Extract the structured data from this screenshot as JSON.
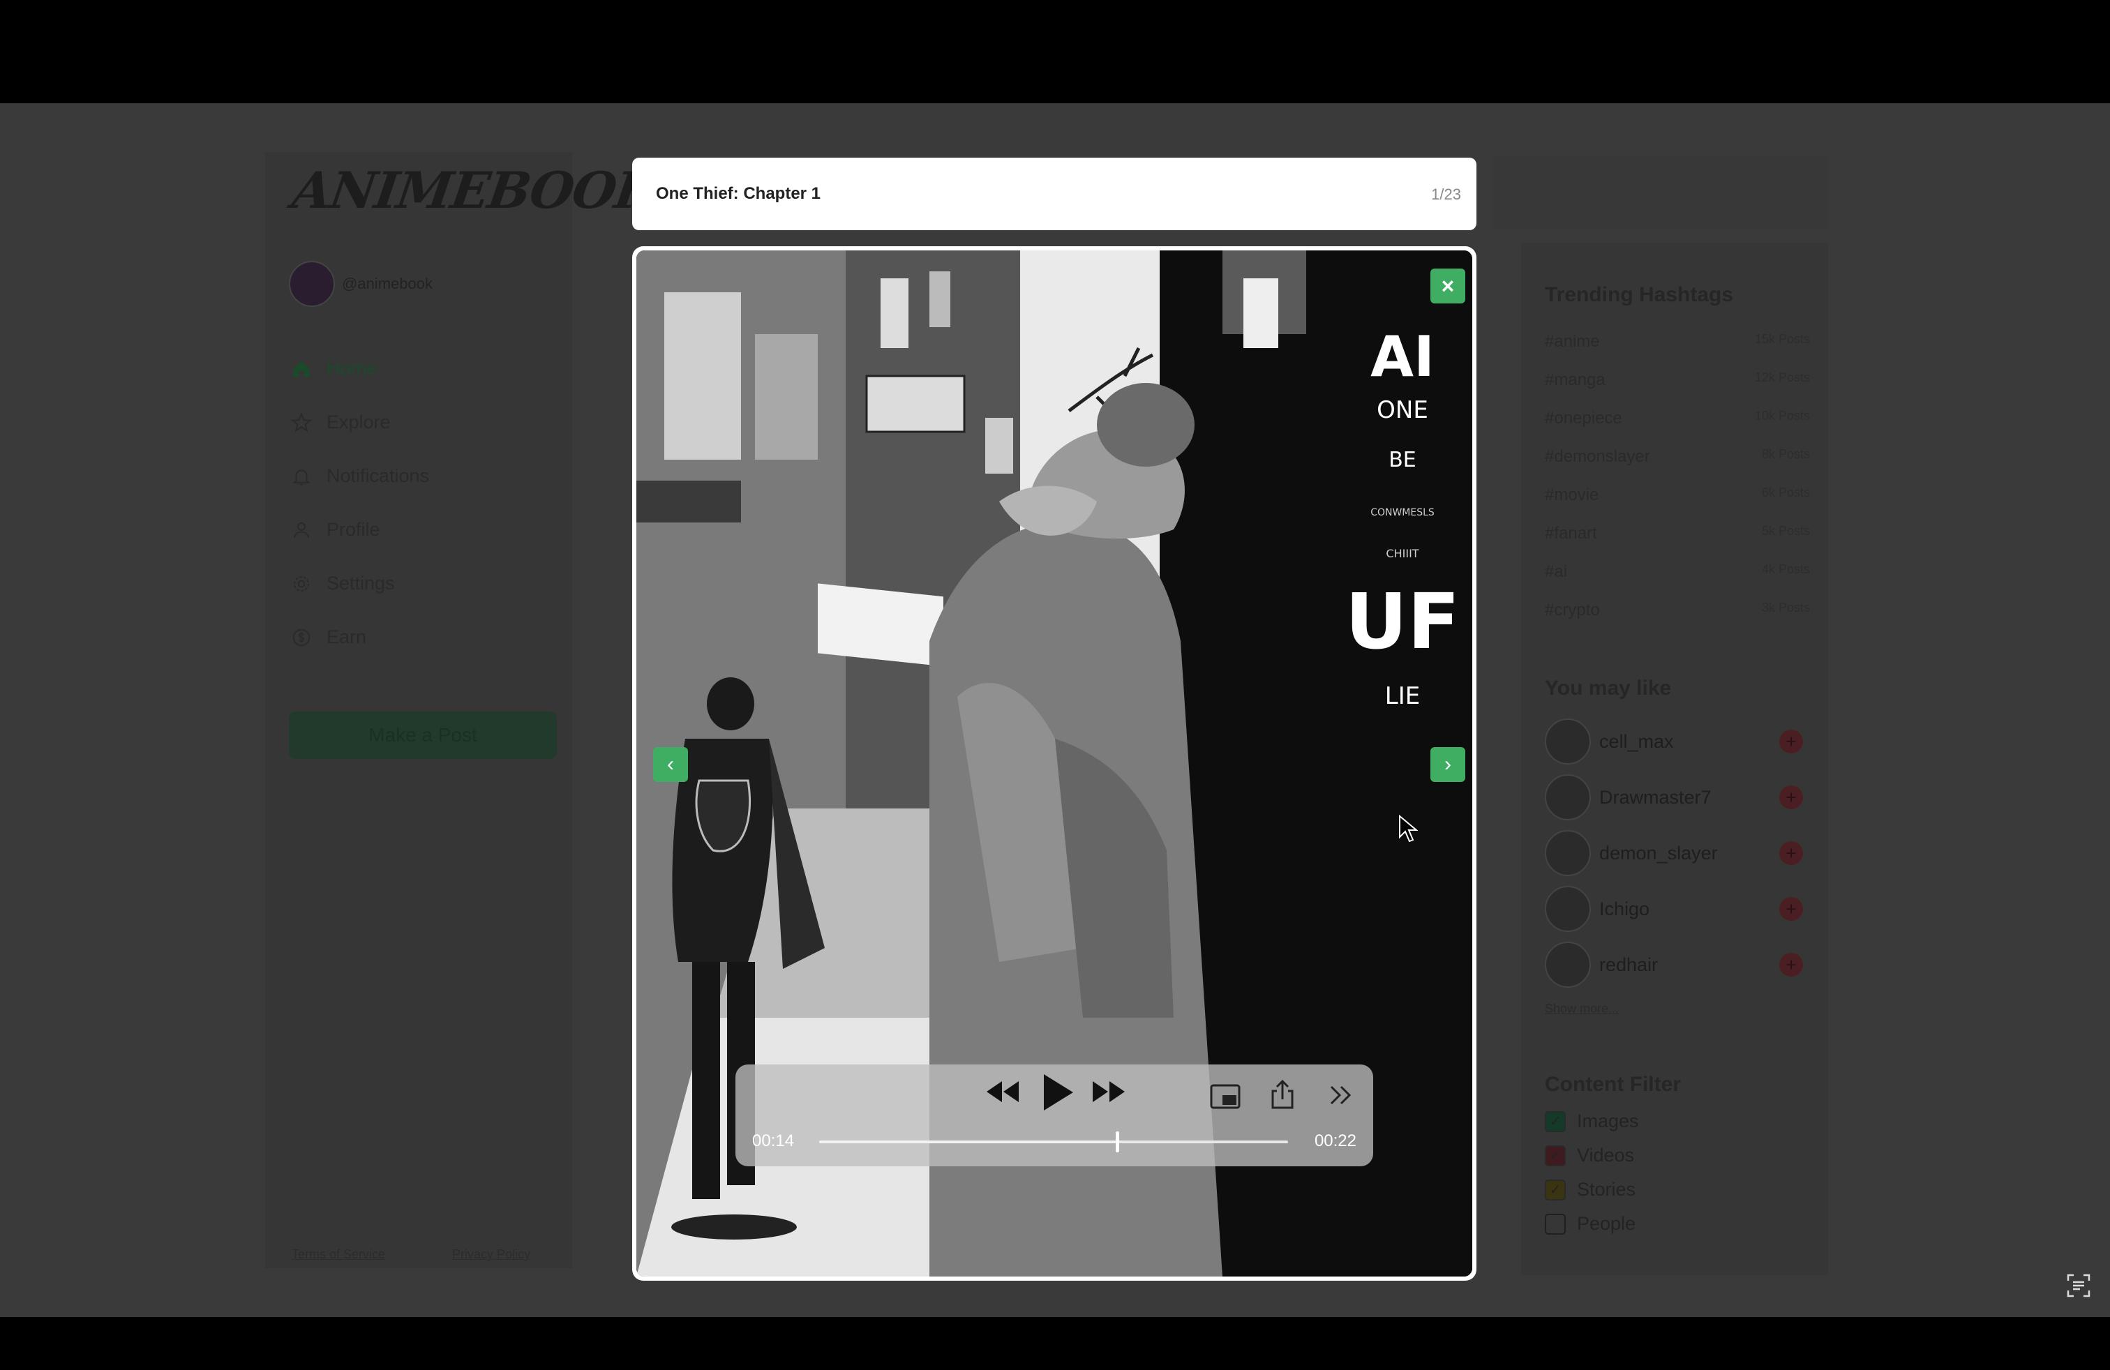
{
  "app": {
    "logo_text": "ANIMEBOOK",
    "handle": "@animebook"
  },
  "nav": {
    "items": [
      {
        "label": "Home",
        "icon": "home-icon"
      },
      {
        "label": "Explore",
        "icon": "star-icon"
      },
      {
        "label": "Notifications",
        "icon": "bell-icon"
      },
      {
        "label": "Profile",
        "icon": "user-icon"
      },
      {
        "label": "Settings",
        "icon": "gear-icon"
      },
      {
        "label": "Earn",
        "icon": "coin-icon"
      }
    ],
    "make_post": "Make a Post"
  },
  "footer": {
    "terms": "Terms of Service",
    "privacy": "Privacy Policy"
  },
  "trending": {
    "title": "Trending Hashtags",
    "items": [
      {
        "tag": "#anime",
        "count": "15k Posts"
      },
      {
        "tag": "#manga",
        "count": "12k Posts"
      },
      {
        "tag": "#onepiece",
        "count": "10k Posts"
      },
      {
        "tag": "#demonslayer",
        "count": "8k Posts"
      },
      {
        "tag": "#movie",
        "count": "6k Posts"
      },
      {
        "tag": "#fanart",
        "count": "5k Posts"
      },
      {
        "tag": "#ai",
        "count": "4k Posts"
      },
      {
        "tag": "#crypto",
        "count": "3k Posts"
      }
    ]
  },
  "you_may_like": {
    "title": "You may like",
    "users": [
      "cell_max",
      "Drawmaster7",
      "demon_slayer",
      "Ichigo",
      "redhair"
    ],
    "show_more": "Show more..."
  },
  "content_filter": {
    "title": "Content Filter",
    "items": [
      {
        "label": "Images",
        "checked": true,
        "color": "#1f8f4e"
      },
      {
        "label": "Videos",
        "checked": true,
        "color": "#c0394a"
      },
      {
        "label": "Stories",
        "checked": true,
        "color": "#c8b42a"
      },
      {
        "label": "People",
        "checked": false,
        "color": "#ffffff"
      }
    ]
  },
  "modal": {
    "title": "One Thief: Chapter 1",
    "counter": "1/23",
    "close": "×",
    "prev": "‹",
    "next": "›"
  },
  "player": {
    "elapsed": "00:14",
    "duration": "00:22",
    "progress": 0.636
  },
  "colors": {
    "accent": "#3fae62",
    "overlay": "#3a3a3a"
  }
}
